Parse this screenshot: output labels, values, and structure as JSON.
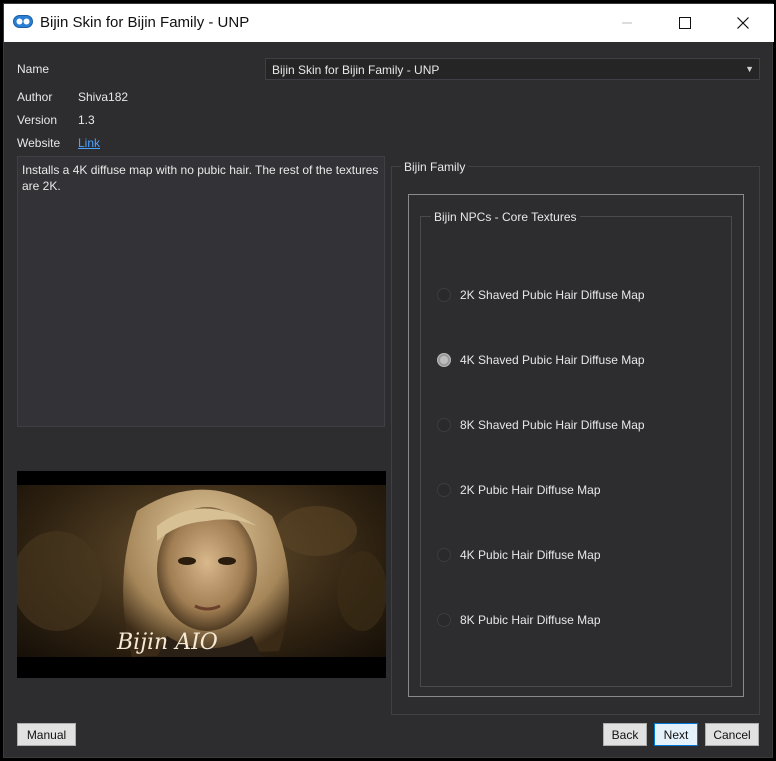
{
  "window": {
    "title": "Bijin Skin for Bijin Family - UNP",
    "controls": [
      "minimize-icon",
      "maximize-icon",
      "close-icon"
    ]
  },
  "info": {
    "name_label": "Name",
    "name_value": "Bijin Skin for Bijin Family - UNP",
    "author_label": "Author",
    "author_value": "Shiva182",
    "version_label": "Version",
    "version_value": "1.3",
    "website_label": "Website",
    "website_link": "Link"
  },
  "description": "Installs a 4K diffuse map with no pubic hair. The rest of the textures are 2K.",
  "preview": {
    "signature": "Bijin AIO"
  },
  "group": {
    "outer_title": "Bijin Family",
    "inner_title": "Bijin NPCs - Core Textures",
    "options": [
      {
        "label": "2K Shaved Pubic Hair Diffuse Map",
        "checked": false
      },
      {
        "label": "4K Shaved Pubic Hair Diffuse Map",
        "checked": true
      },
      {
        "label": "8K Shaved Pubic Hair Diffuse Map",
        "checked": false
      },
      {
        "label": "2K Pubic Hair Diffuse Map",
        "checked": false
      },
      {
        "label": "4K Pubic Hair Diffuse Map",
        "checked": false
      },
      {
        "label": "8K Pubic Hair Diffuse Map",
        "checked": false
      }
    ]
  },
  "buttons": {
    "manual": "Manual",
    "back": "Back",
    "next": "Next",
    "cancel": "Cancel"
  },
  "colors": {
    "background": "#2d2d30",
    "link": "#4aa3ff",
    "accent": "#0078d7"
  }
}
